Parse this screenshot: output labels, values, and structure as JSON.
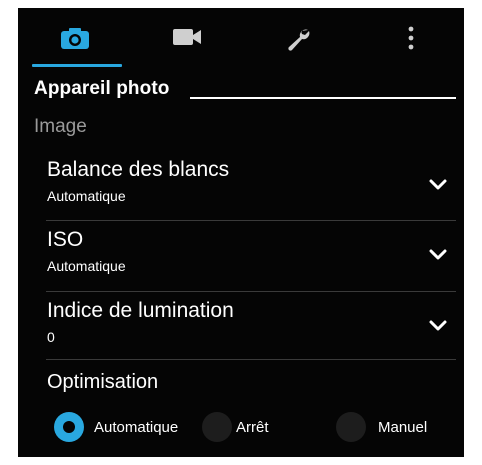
{
  "tabs": [
    {
      "icon": "camera-icon",
      "selected": true
    },
    {
      "icon": "video-camera-icon",
      "selected": false
    },
    {
      "icon": "wrench-icon",
      "selected": false
    },
    {
      "icon": "more-vertical-icon",
      "selected": false
    }
  ],
  "section": {
    "title": "Appareil photo"
  },
  "category": {
    "label": "Image"
  },
  "settings": [
    {
      "title": "Balance des blancs",
      "value": "Automatique"
    },
    {
      "title": "ISO",
      "value": "Automatique"
    },
    {
      "title": "Indice de lumination",
      "value": "0"
    }
  ],
  "optimisation": {
    "title": "Optimisation",
    "options": [
      {
        "label": "Automatique",
        "selected": true
      },
      {
        "label": "Arrêt",
        "selected": false
      },
      {
        "label": "Manuel",
        "selected": false
      }
    ]
  },
  "colors": {
    "accent": "#29a8e0",
    "background": "#050505",
    "muted": "#9a9a9a"
  }
}
